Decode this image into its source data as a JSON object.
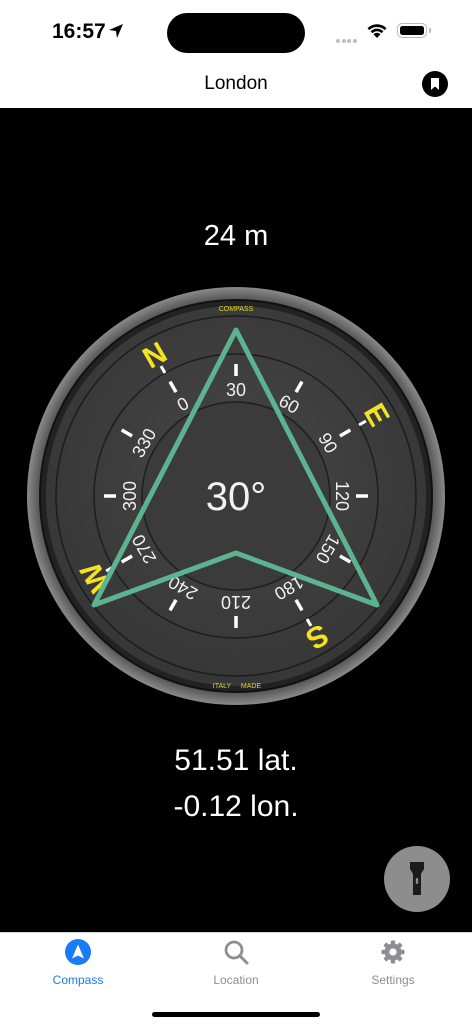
{
  "status_bar": {
    "time": "16:57"
  },
  "nav": {
    "title": "London",
    "bookmark_icon": "bookmark-icon"
  },
  "compass": {
    "altitude": "24 m",
    "heading_readout": "30°",
    "heading_deg": 30,
    "brand_top": "COMPASS",
    "brand_bottom_left": "ITALY",
    "brand_bottom_right": "MADE",
    "cardinals": [
      "N",
      "E",
      "S",
      "W"
    ],
    "degree_labels": [
      "0",
      "30",
      "60",
      "90",
      "120",
      "150",
      "180",
      "210",
      "240",
      "270",
      "300",
      "330"
    ],
    "cardinal_color": "#f2e221",
    "needle_color": "#5cb393"
  },
  "coordinates": {
    "lat": "51.51 lat.",
    "lon": "-0.12 lon."
  },
  "flashlight": {
    "icon": "flashlight-icon"
  },
  "tabs": [
    {
      "label": "Compass",
      "icon": "navigation-arrow-icon",
      "active": true
    },
    {
      "label": "Location",
      "icon": "search-icon",
      "active": false
    },
    {
      "label": "Settings",
      "icon": "gear-icon",
      "active": false
    }
  ],
  "colors": {
    "active_tab": "#1a7cf5",
    "inactive_tab": "#8e8e93"
  }
}
